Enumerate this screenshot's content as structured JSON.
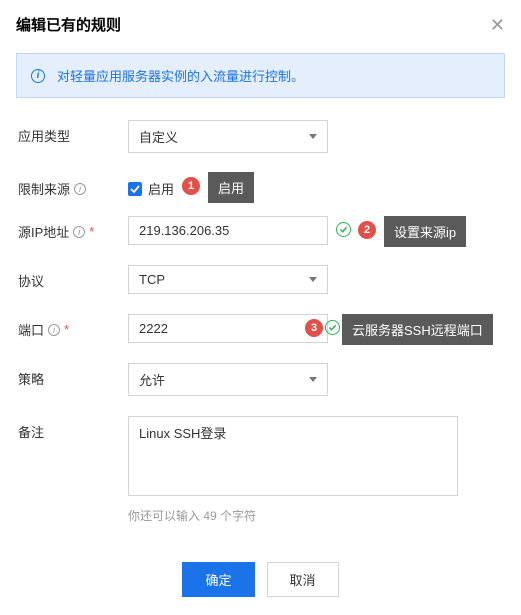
{
  "modal": {
    "title": "编辑已有的规则",
    "info": "对轻量应用服务器实例的入流量进行控制。"
  },
  "form": {
    "app_type": {
      "label": "应用类型",
      "value": "自定义"
    },
    "restrict": {
      "label": "限制来源",
      "checkbox_label": "启用"
    },
    "source_ip": {
      "label": "源IP地址",
      "value": "219.136.206.35"
    },
    "protocol": {
      "label": "协议",
      "value": "TCP"
    },
    "port": {
      "label": "端口",
      "value": "2222"
    },
    "policy": {
      "label": "策略",
      "value": "允许"
    },
    "remark": {
      "label": "备注",
      "value": "Linux SSH登录",
      "hint": "你还可以输入 49 个字符"
    }
  },
  "annotations": {
    "step1": "1",
    "tip1": "启用",
    "step2": "2",
    "tip2": "设置来源ip",
    "step3": "3",
    "tip3": "云服务器SSH远程端口"
  },
  "buttons": {
    "ok": "确定",
    "cancel": "取消"
  }
}
